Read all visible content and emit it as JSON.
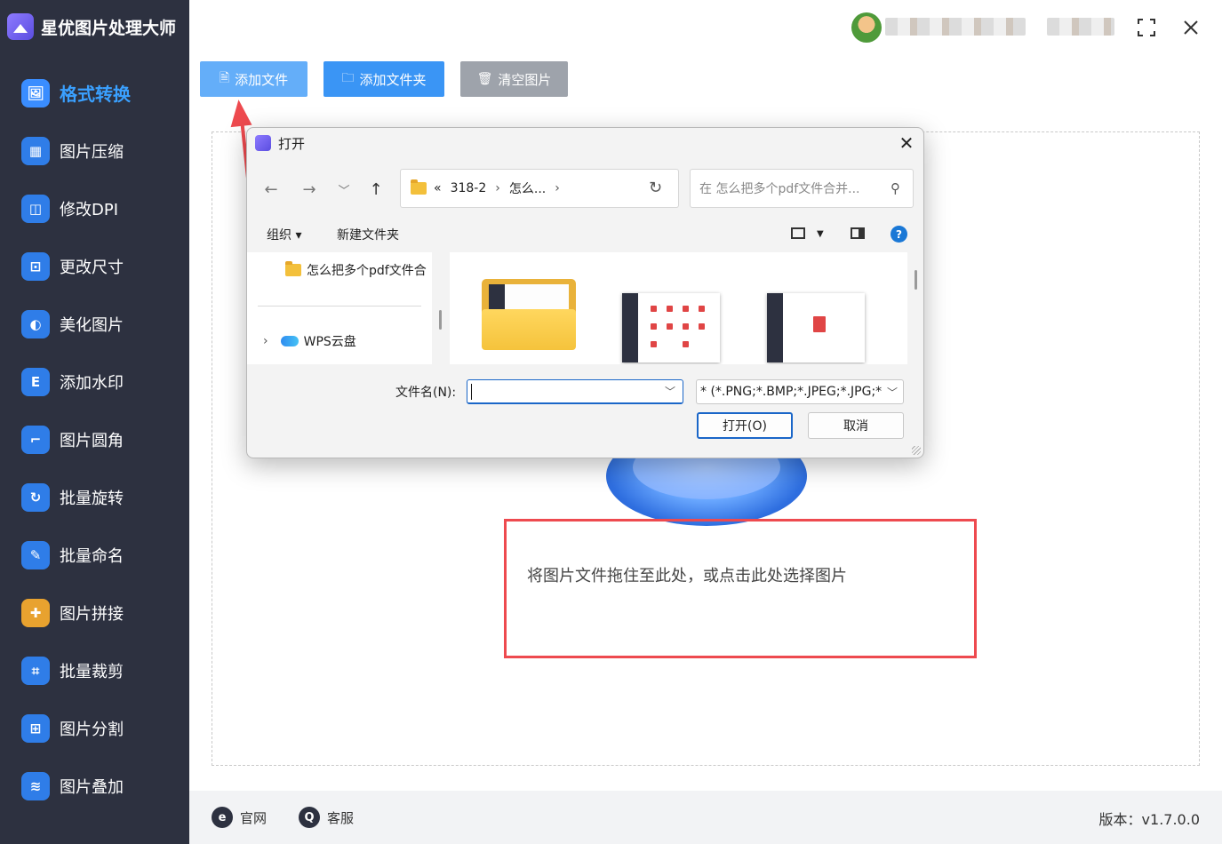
{
  "app": {
    "title": "星优图片处理大师",
    "version": "版本：v1.7.0.0"
  },
  "sidebar": {
    "items": [
      {
        "label": "格式转换",
        "icon": "image-convert-icon",
        "color": "#3a8dff",
        "active": true
      },
      {
        "label": "图片压缩",
        "icon": "image-compress-icon",
        "color": "#2f7de8"
      },
      {
        "label": "修改DPI",
        "icon": "dpi-icon",
        "color": "#2f7de8"
      },
      {
        "label": "更改尺寸",
        "icon": "resize-icon",
        "color": "#2f7de8"
      },
      {
        "label": "美化图片",
        "icon": "beautify-icon",
        "color": "#2f7de8"
      },
      {
        "label": "添加水印",
        "icon": "watermark-icon",
        "color": "#2f7de8"
      },
      {
        "label": "图片圆角",
        "icon": "rounded-corner-icon",
        "color": "#2f7de8"
      },
      {
        "label": "批量旋转",
        "icon": "rotate-icon",
        "color": "#2f7de8"
      },
      {
        "label": "批量命名",
        "icon": "rename-icon",
        "color": "#2f7de8"
      },
      {
        "label": "图片拼接",
        "icon": "puzzle-icon",
        "color": "#e8a22f"
      },
      {
        "label": "批量裁剪",
        "icon": "crop-icon",
        "color": "#2f7de8"
      },
      {
        "label": "图片分割",
        "icon": "split-icon",
        "color": "#2f7de8"
      },
      {
        "label": "图片叠加",
        "icon": "layers-icon",
        "color": "#2f7de8"
      }
    ]
  },
  "toolbar": {
    "add_file": "添加文件",
    "add_folder": "添加文件夹",
    "clear_images": "清空图片",
    "colors": {
      "add_file": "#64aef9",
      "add_folder": "#3a95f5",
      "clear": "#9ea3ab"
    }
  },
  "drop_zone": {
    "text": "将图片文件拖住至此处，或点击此处选择图片"
  },
  "footer": {
    "website": "官网",
    "support": "客服"
  },
  "dialog": {
    "title": "打开",
    "breadcrumb": [
      "«",
      "318-2",
      "›",
      "怎么...",
      "›"
    ],
    "search_placeholder": "在 怎么把多个pdf文件合并...",
    "organize": "组织 ▾",
    "new_folder": "新建文件夹",
    "tree": {
      "folder": "怎么把多个pdf文件合",
      "cloud": "WPS云盘"
    },
    "filename_label": "文件名(N):",
    "filename_value": "",
    "filetype": "* (*.PNG;*.BMP;*.JPEG;*.JPG;*",
    "open_button": "打开(O)",
    "cancel_button": "取消"
  },
  "accent": "#3aa0ff",
  "highlight": "#ee4a4f"
}
